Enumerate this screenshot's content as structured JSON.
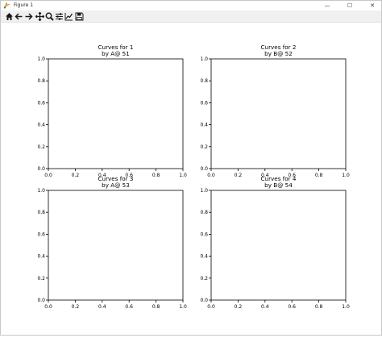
{
  "window": {
    "title": "Figure 1",
    "controls": {
      "minimize": "—",
      "maximize": "☐",
      "close": "✕"
    }
  },
  "toolbar": {
    "tools": [
      "home-icon",
      "back-arrow-icon",
      "forward-arrow-icon",
      "pan-icon",
      "zoom-icon",
      "subplots-config-icon",
      "edit-axis-icon",
      "save-icon"
    ]
  },
  "chart_data": [
    {
      "type": "line",
      "title": "Curves for 1\nby A@ 51",
      "title_lines": [
        "Curves for 1",
        "by A@ 51"
      ],
      "xlim": [
        0,
        1
      ],
      "ylim": [
        0,
        1
      ],
      "xticks": [
        "0.0",
        "0.2",
        "0.4",
        "0.6",
        "0.8",
        "1.0"
      ],
      "yticks": [
        "0.0",
        "0.2",
        "0.4",
        "0.6",
        "0.8",
        "1.0"
      ],
      "series": []
    },
    {
      "type": "line",
      "title": "Curves for 2\nby B@ 52",
      "title_lines": [
        "Curves for 2",
        "by B@ 52"
      ],
      "xlim": [
        0,
        1
      ],
      "ylim": [
        0,
        1
      ],
      "xticks": [
        "0.0",
        "0.2",
        "0.4",
        "0.6",
        "0.8",
        "1.0"
      ],
      "yticks": [
        "0.0",
        "0.2",
        "0.4",
        "0.6",
        "0.8",
        "1.0"
      ],
      "series": []
    },
    {
      "type": "line",
      "title": "Curves for 3\nby A@ 53",
      "title_lines": [
        "Curves for 3",
        "by A@ 53"
      ],
      "xlim": [
        0,
        1
      ],
      "ylim": [
        0,
        1
      ],
      "xticks": [
        "0.0",
        "0.2",
        "0.4",
        "0.6",
        "0.8",
        "1.0"
      ],
      "yticks": [
        "0.0",
        "0.2",
        "0.4",
        "0.6",
        "0.8",
        "1.0"
      ],
      "series": []
    },
    {
      "type": "line",
      "title": "Curves for 4\nby B@ 54",
      "title_lines": [
        "Curves for 4",
        "by B@ 54"
      ],
      "xlim": [
        0,
        1
      ],
      "ylim": [
        0,
        1
      ],
      "xticks": [
        "0.0",
        "0.2",
        "0.4",
        "0.6",
        "0.8",
        "1.0"
      ],
      "yticks": [
        "0.0",
        "0.2",
        "0.4",
        "0.6",
        "0.8",
        "1.0"
      ],
      "series": []
    }
  ]
}
